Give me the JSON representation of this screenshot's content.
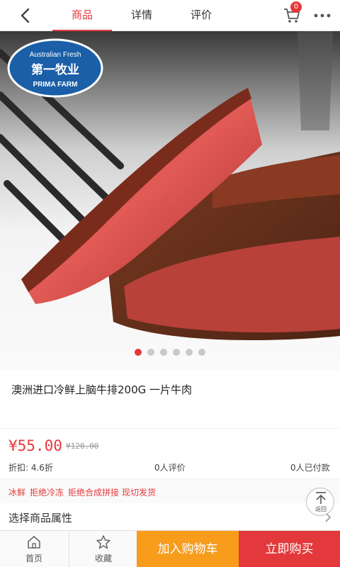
{
  "header": {
    "tabs": [
      {
        "label": "商品"
      },
      {
        "label": "详情"
      },
      {
        "label": "评价"
      }
    ],
    "cart_count": "0",
    "icons": {
      "back": "back-arrow-icon",
      "cart": "cart-icon",
      "more": "more-dots-icon"
    }
  },
  "hero": {
    "logo_top": "Australian Fresh",
    "logo_main": "第一牧业",
    "logo_bottom": "PRIMA FARM",
    "slide_count": 6,
    "active_slide": 1
  },
  "product": {
    "title": "澳洲进口冷鲜上脑牛排200G 一片牛肉",
    "price": "¥55.00",
    "old_price": "¥120.00",
    "discount": "折扣: 4.6折",
    "reviews": "0人评价",
    "paid": "0人已付款",
    "tags": [
      "冰鲜",
      "拒绝冷冻",
      "拒绝合成拼接",
      "现切发货"
    ]
  },
  "attributes": {
    "label": "选择商品属性"
  },
  "back_top": {
    "label": "返回"
  },
  "bottom_bar": {
    "home": "首页",
    "favorite": "收藏",
    "add_cart": "加入购物车",
    "buy_now": "立即购买"
  },
  "colors": {
    "accent": "#e4393c",
    "orange": "#f89c1c"
  }
}
